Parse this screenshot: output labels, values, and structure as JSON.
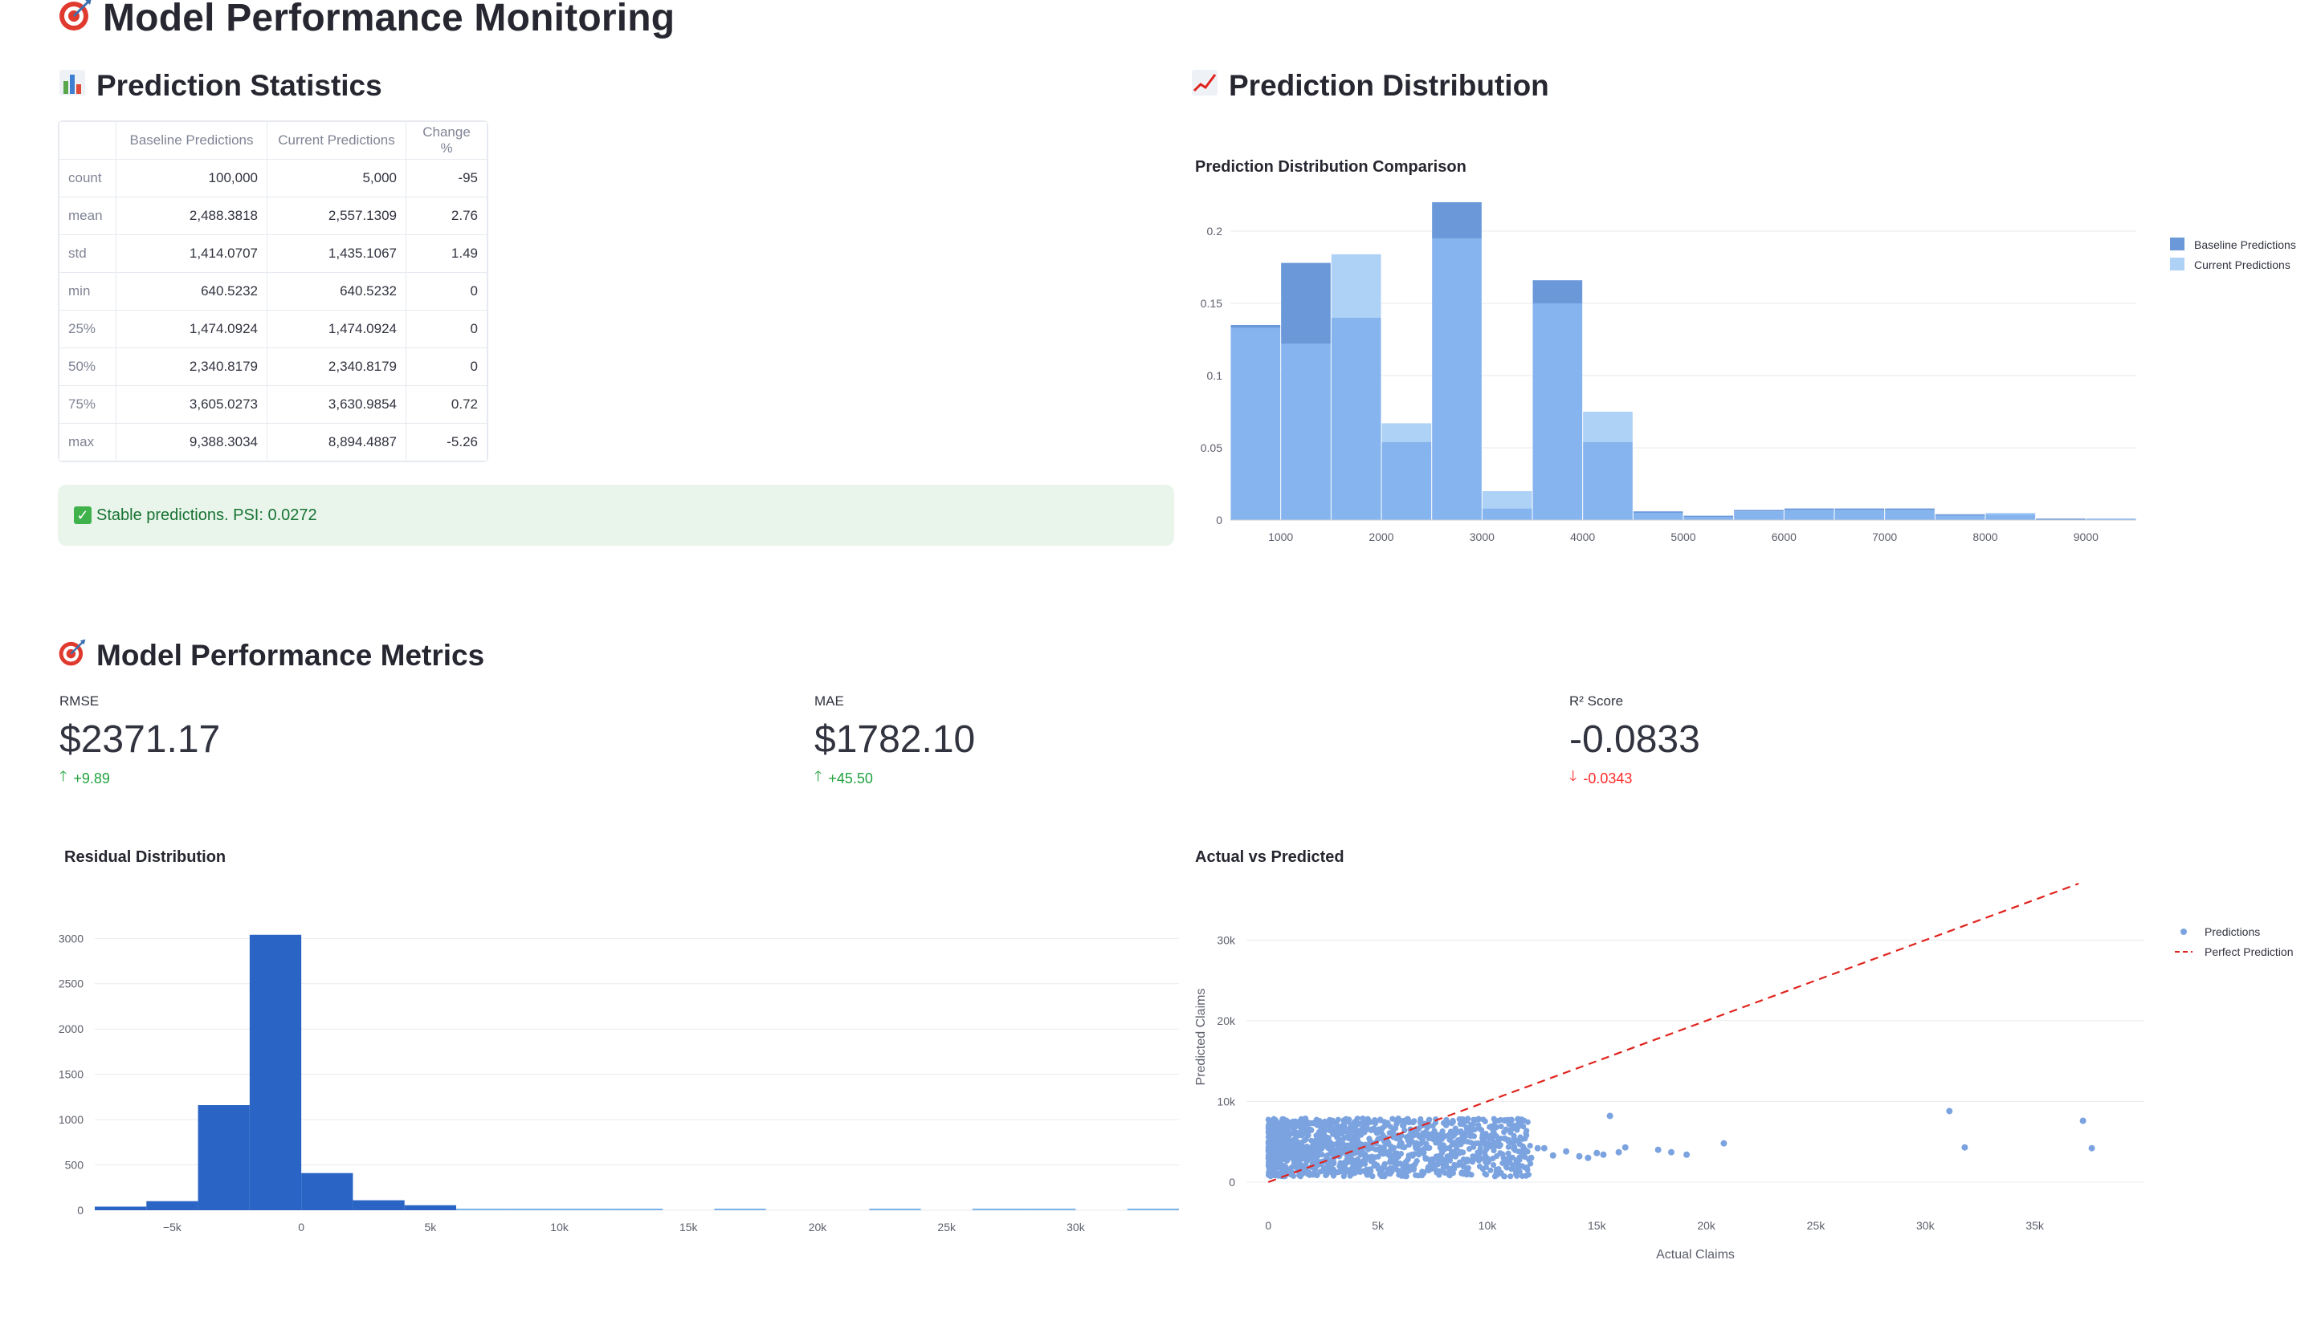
{
  "page": {
    "title": "Model Performance Monitoring",
    "title_icon": "target-icon"
  },
  "prediction_statistics": {
    "title": "Prediction Statistics",
    "title_icon": "bar-chart-icon",
    "columns": [
      "",
      "Baseline Predictions",
      "Current Predictions",
      "Change %"
    ],
    "rows": [
      {
        "label": "count",
        "baseline": "100,000",
        "current": "5,000",
        "change": "-95"
      },
      {
        "label": "mean",
        "baseline": "2,488.3818",
        "current": "2,557.1309",
        "change": "2.76"
      },
      {
        "label": "std",
        "baseline": "1,414.0707",
        "current": "1,435.1067",
        "change": "1.49"
      },
      {
        "label": "min",
        "baseline": "640.5232",
        "current": "640.5232",
        "change": "0"
      },
      {
        "label": "25%",
        "baseline": "1,474.0924",
        "current": "1,474.0924",
        "change": "0"
      },
      {
        "label": "50%",
        "baseline": "2,340.8179",
        "current": "2,340.8179",
        "change": "0"
      },
      {
        "label": "75%",
        "baseline": "3,605.0273",
        "current": "3,630.9854",
        "change": "0.72"
      },
      {
        "label": "max",
        "baseline": "9,388.3034",
        "current": "8,894.4887",
        "change": "-5.26"
      }
    ],
    "status_message": "Stable predictions. PSI: 0.0272",
    "status_icon": "check-mark-icon"
  },
  "prediction_distribution": {
    "title": "Prediction Distribution",
    "title_icon": "chart-increasing-icon"
  },
  "performance_metrics": {
    "title": "Model Performance Metrics",
    "title_icon": "target-icon",
    "metrics": [
      {
        "label": "RMSE",
        "value": "$2371.17",
        "delta": "+9.89",
        "direction": "up"
      },
      {
        "label": "MAE",
        "value": "$1782.10",
        "delta": "+45.50",
        "direction": "up"
      },
      {
        "label": "R² Score",
        "value": "-0.0833",
        "delta": "-0.0343",
        "direction": "down"
      }
    ]
  },
  "colors": {
    "baseline": "#6a98d9",
    "current": "#aed1f6",
    "overlap": "#86b4ee",
    "residual": "#2a65c6",
    "residual_light": "#7fb2ea",
    "scatter": "#7ba3e0",
    "perfect_line": "#e0231d",
    "success_bg": "#e9f5ea",
    "success_text": "#177233",
    "delta_up": "#21a23f",
    "delta_down": "#ff2b2b"
  },
  "chart_data": [
    {
      "id": "prediction_distribution",
      "type": "bar",
      "title": "Prediction Distribution Comparison",
      "xlabel": "",
      "ylabel": "",
      "x_ticks": [
        1000,
        2000,
        3000,
        4000,
        5000,
        6000,
        7000,
        8000,
        9000
      ],
      "y_ticks": [
        0,
        0.05,
        0.1,
        0.15,
        0.2
      ],
      "xlim": [
        500,
        9500
      ],
      "ylim": [
        0,
        0.22
      ],
      "bin_edges": [
        500,
        1000,
        1500,
        2000,
        2500,
        3000,
        3500,
        4000,
        4500,
        5000,
        5500,
        6000,
        6500,
        7000,
        7500,
        8000,
        8500,
        9000,
        9500
      ],
      "legend_position": "top-right",
      "series": [
        {
          "name": "Baseline Predictions",
          "values": [
            0.135,
            0.178,
            0.14,
            0.054,
            0.22,
            0.008,
            0.166,
            0.054,
            0.006,
            0.003,
            0.007,
            0.008,
            0.008,
            0.008,
            0.004,
            0.004,
            0.001,
            0.001
          ]
        },
        {
          "name": "Current Predictions",
          "values": [
            0.133,
            0.122,
            0.184,
            0.067,
            0.195,
            0.02,
            0.15,
            0.075,
            0.005,
            0.002,
            0.006,
            0.007,
            0.007,
            0.007,
            0.003,
            0.005,
            0.0,
            0.001
          ]
        }
      ]
    },
    {
      "id": "residual_distribution",
      "type": "bar",
      "title": "Residual Distribution",
      "xlabel": "",
      "ylabel": "",
      "x_ticks": [
        -5000,
        0,
        5000,
        10000,
        15000,
        20000,
        25000,
        30000
      ],
      "x_tick_labels": [
        "−5k",
        "0",
        "5k",
        "10k",
        "15k",
        "20k",
        "25k",
        "30k"
      ],
      "y_ticks": [
        0,
        500,
        1000,
        1500,
        2000,
        2500,
        3000
      ],
      "xlim": [
        -8000,
        34000
      ],
      "ylim": [
        0,
        3100
      ],
      "bin_edges": [
        -8000,
        -6000,
        -4000,
        -2000,
        0,
        2000,
        4000,
        6000,
        8000,
        10000,
        12000,
        14000,
        16000,
        18000,
        20000,
        22000,
        24000,
        26000,
        28000,
        30000,
        32000,
        34000
      ],
      "values": [
        40,
        100,
        1160,
        3040,
        410,
        110,
        55,
        15,
        5,
        5,
        4,
        0,
        3,
        0,
        0,
        4,
        0,
        3,
        3,
        0,
        2
      ]
    },
    {
      "id": "actual_vs_predicted",
      "type": "scatter",
      "title": "Actual vs Predicted",
      "xlabel": "Actual Claims",
      "ylabel": "Predicted Claims",
      "x_ticks": [
        0,
        5000,
        10000,
        15000,
        20000,
        25000,
        30000,
        35000
      ],
      "x_tick_labels": [
        "0",
        "5k",
        "10k",
        "15k",
        "20k",
        "25k",
        "30k",
        "35k"
      ],
      "y_ticks": [
        0,
        10000,
        20000,
        30000
      ],
      "y_tick_labels": [
        "0",
        "10k",
        "20k",
        "30k"
      ],
      "xlim": [
        -1000,
        40000
      ],
      "ylim": [
        -1500,
        37500
      ],
      "legend_position": "top-right",
      "series": [
        {
          "name": "Predictions",
          "mode": "markers",
          "x": [
            15600,
            13600,
            16300,
            17800,
            19100,
            14600,
            11400,
            12600,
            12000,
            13000,
            15000,
            16000,
            14200,
            15300,
            20800,
            18400,
            31100,
            31800,
            37200,
            37600,
            10400,
            10800,
            11100,
            9600,
            9300,
            8900,
            9900,
            10200,
            11700,
            12300
          ],
          "y": [
            8200,
            3800,
            4300,
            4000,
            3400,
            3000,
            7800,
            4200,
            3000,
            3300,
            3600,
            3700,
            3200,
            3400,
            4800,
            3700,
            8800,
            4300,
            7600,
            4200,
            6800,
            5400,
            7700,
            7800,
            6500,
            7200,
            3100,
            6900,
            3700,
            4200
          ]
        },
        {
          "name": "Perfect Prediction",
          "mode": "lines",
          "x": [
            0,
            37000
          ],
          "y": [
            0,
            37000
          ]
        }
      ]
    }
  ]
}
